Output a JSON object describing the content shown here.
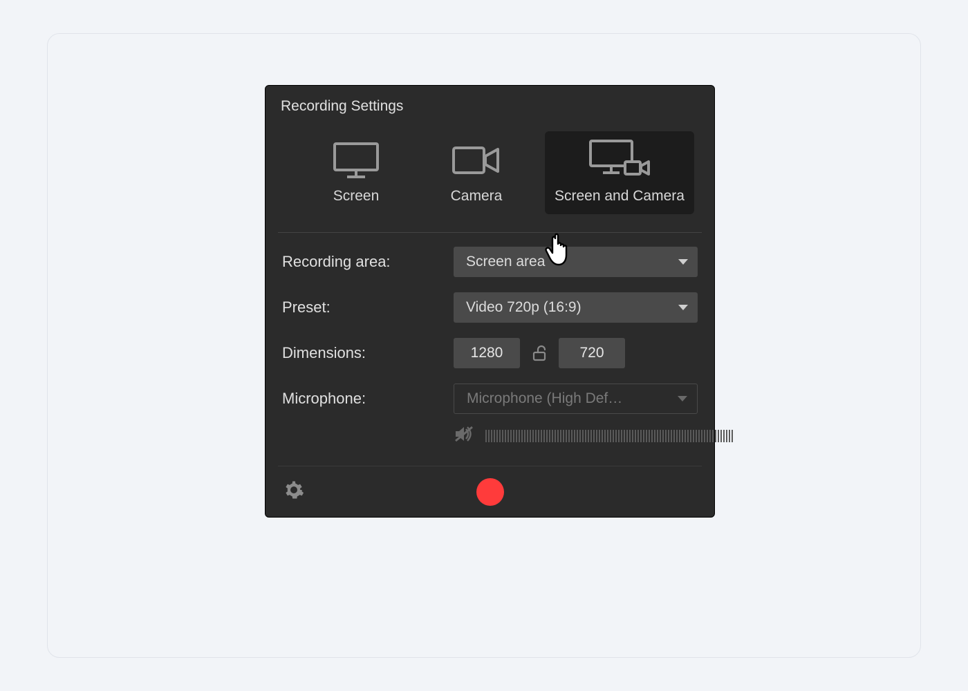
{
  "panel": {
    "title": "Recording Settings"
  },
  "modes": {
    "screen": "Screen",
    "camera": "Camera",
    "screen_camera": "Screen and Camera",
    "selected": "screen_camera"
  },
  "settings": {
    "recording_area": {
      "label": "Recording area:",
      "value": "Screen area"
    },
    "preset": {
      "label": "Preset:",
      "value": "Video 720p (16:9)"
    },
    "dimensions": {
      "label": "Dimensions:",
      "width": "1280",
      "height": "720"
    },
    "microphone": {
      "label": "Microphone:",
      "value": "Microphone (High Def…"
    }
  },
  "colors": {
    "record": "#ff3b3b",
    "panel_bg": "#2b2b2b",
    "select_bg": "#4a4a4a"
  }
}
